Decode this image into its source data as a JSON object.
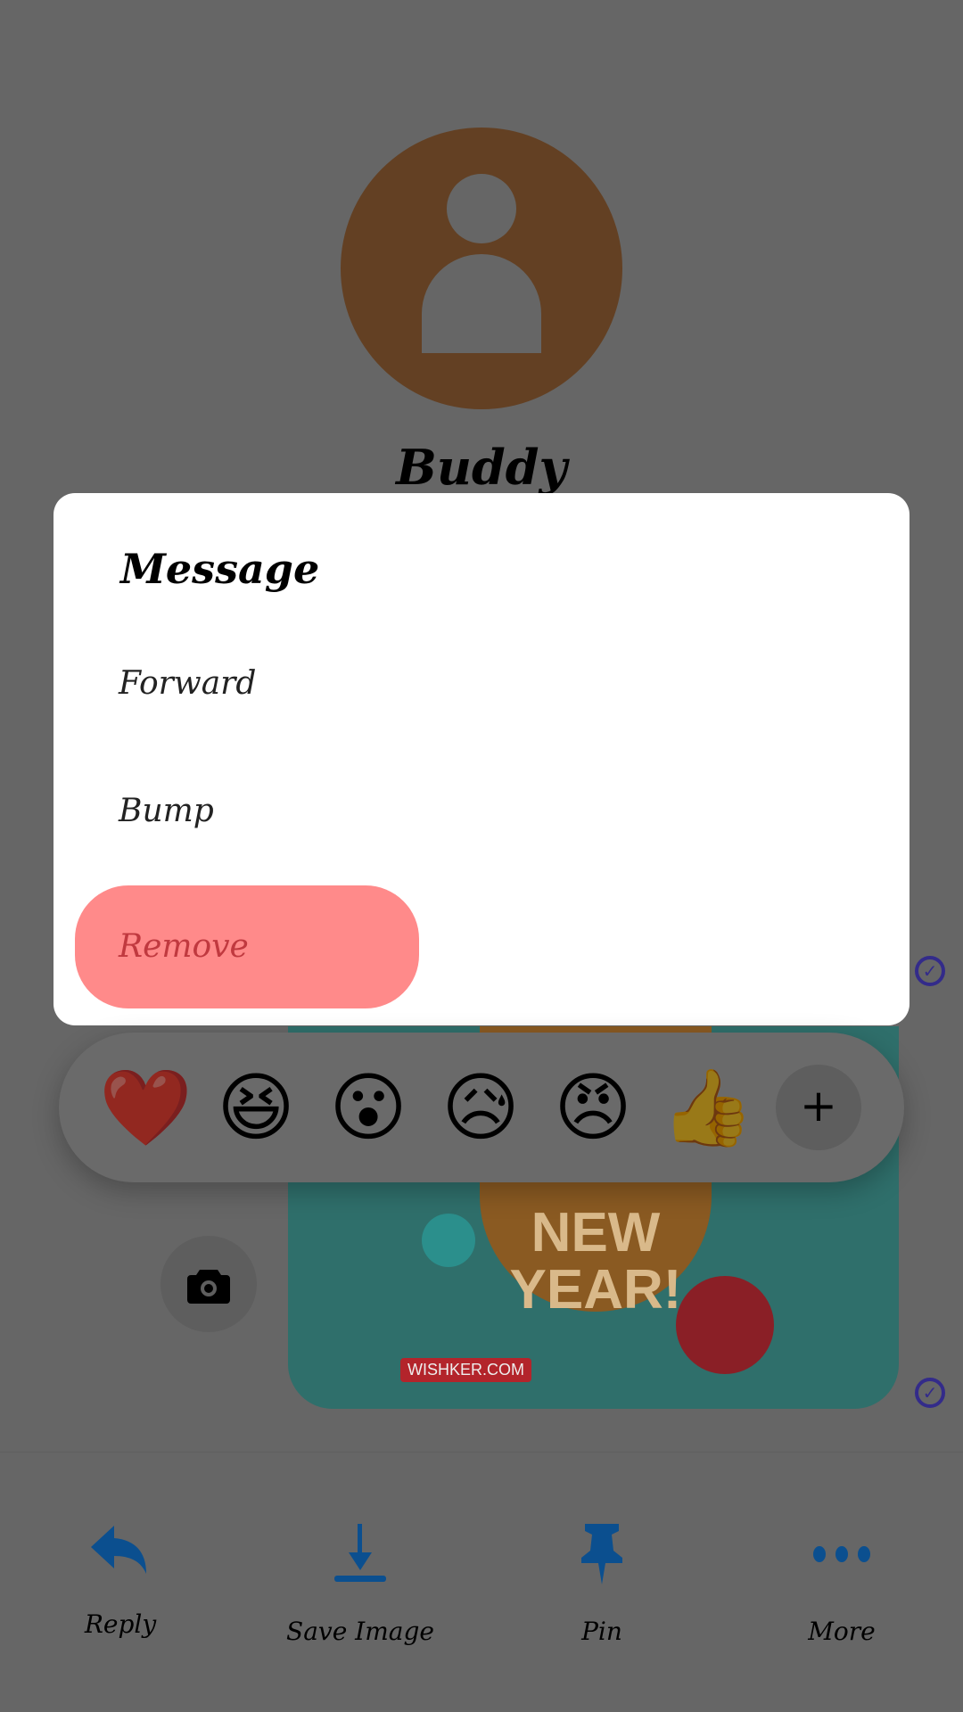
{
  "contact": {
    "name": "Buddy"
  },
  "dialog": {
    "title": "Message",
    "options": [
      {
        "label": "Forward"
      },
      {
        "label": "Bump"
      },
      {
        "label": "Remove"
      }
    ]
  },
  "reactions": {
    "items": [
      {
        "emoji": "❤️",
        "icon": "heart"
      },
      {
        "emoji": "😆",
        "icon": "laughing"
      },
      {
        "emoji": "😮",
        "icon": "surprised"
      },
      {
        "emoji": "😥",
        "icon": "sad"
      },
      {
        "emoji": "😠",
        "icon": "angry"
      },
      {
        "emoji": "👍",
        "icon": "thumbs-up"
      }
    ],
    "more": "+"
  },
  "message": {
    "image_text": "NEW YEAR!",
    "watermark": "WISHKER.COM"
  },
  "actions": [
    {
      "label": "Reply",
      "icon": "reply-icon"
    },
    {
      "label": "Save Image",
      "icon": "download-icon"
    },
    {
      "label": "Pin",
      "icon": "pin-icon"
    },
    {
      "label": "More",
      "icon": "more-icon"
    }
  ],
  "colors": {
    "accent": "#0b4f8f",
    "remove_bg": "#ff8a8a",
    "remove_text": "#c0393f",
    "avatar": "#634023",
    "check": "#332b8a"
  }
}
